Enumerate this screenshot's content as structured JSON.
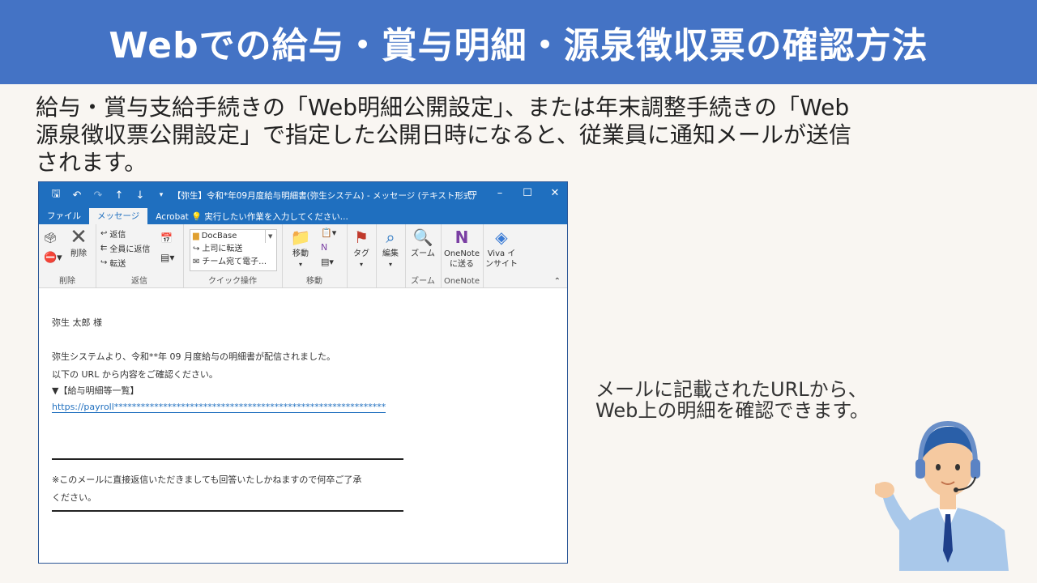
{
  "header": {
    "title": "Webでの給与・賞与明細・源泉徴収票の確認方法"
  },
  "intro": {
    "line1": "給与・賞与支給手続きの「Web明細公開設定」、または年末調整手続きの「Web",
    "line2": "源泉徴収票公開設定」で指定した公開日時になると、従業員に通知メールが送信",
    "line3": "されます。"
  },
  "outlook": {
    "window_title": "【弥生】令和*年09月度給与明細書(弥生システム) - メッセージ (テキスト形式)",
    "qat_icons": [
      "save-icon",
      "undo-icon",
      "redo-icon",
      "up-arrow-icon",
      "down-arrow-icon",
      "customize-icon"
    ],
    "tabs": [
      "ファイル",
      "メッセージ",
      "Acrobat"
    ],
    "active_tab": "メッセージ",
    "tell_me": "実行したい作業を入力してください...",
    "ribbon": {
      "delete_group": "削除",
      "delete_label": "削除",
      "respond_group": "返信",
      "reply": "返信",
      "reply_all": "全員に返信",
      "forward": "転送",
      "quick_steps_group": "クイック操作",
      "quick_steps": [
        "DocBase",
        "上司に転送",
        "チーム宛て電子…"
      ],
      "move_group": "移動",
      "move": "移動",
      "tags": "タグ",
      "editing": "編集",
      "zoom_group": "ズーム",
      "zoom": "ズーム",
      "onenote_group": "OneNote",
      "onenote_1": "OneNote",
      "onenote_2": "に送る",
      "viva_1": "Viva イ",
      "viva_2": "ンサイト"
    },
    "message": {
      "salutation": "弥生 太郎 様",
      "line1": "弥生システムより、令和**年 09 月度給与の明細書が配信されました。",
      "line2": "以下の URL から内容をご確認ください。",
      "line3": "▼【給与明細等一覧】",
      "url": "https://payroll*************************************************************",
      "notice1": "※このメールに直接返信いただきましても回答いたしかねますので何卒ご了承",
      "notice2": "ください。"
    }
  },
  "caption": {
    "line1": "メールに記載されたURLから、",
    "line2": "Web上の明細を確認できます。"
  },
  "colors": {
    "header_bg": "#4473c5",
    "outlook_blue": "#1f6fbf",
    "page_bg": "#f9f6f2"
  }
}
